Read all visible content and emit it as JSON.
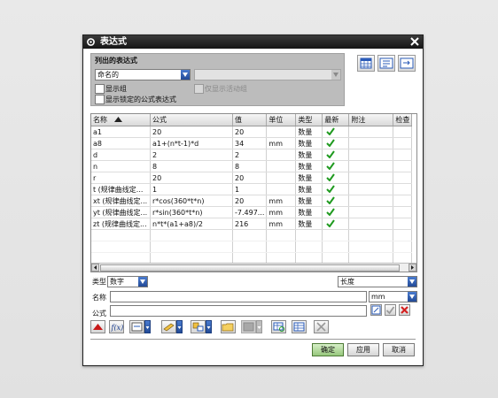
{
  "dialog": {
    "title": "表达式"
  },
  "list_group": {
    "title": "列出的表达式",
    "filter_value": "命名的",
    "secondary_value": "",
    "show_groups_label": "显示组",
    "active_group_only_label": "仅显示活动组",
    "show_locked_label": "显示锁定的公式表达式"
  },
  "table": {
    "columns": [
      "名称",
      "公式",
      "值",
      "单位",
      "类型",
      "最新",
      "附注",
      "检查"
    ],
    "rows": [
      {
        "name": "a1",
        "formula": "20",
        "value": "20",
        "unit": "",
        "type": "数量",
        "uptodate": true
      },
      {
        "name": "a8",
        "formula": "a1+(n*t-1)*d",
        "value": "34",
        "unit": "mm",
        "type": "数量",
        "uptodate": true
      },
      {
        "name": "d",
        "formula": "2",
        "value": "2",
        "unit": "",
        "type": "数量",
        "uptodate": true
      },
      {
        "name": "n",
        "formula": "8",
        "value": "8",
        "unit": "",
        "type": "数量",
        "uptodate": true
      },
      {
        "name": "r",
        "formula": "20",
        "value": "20",
        "unit": "",
        "type": "数量",
        "uptodate": true
      },
      {
        "name": "t (规律曲线定...",
        "formula": "1",
        "value": "1",
        "unit": "",
        "type": "数量",
        "uptodate": true
      },
      {
        "name": "xt (规律曲线定...",
        "formula": "r*cos(360*t*n)",
        "value": "20",
        "unit": "mm",
        "type": "数量",
        "uptodate": true
      },
      {
        "name": "yt (规律曲线定...",
        "formula": "r*sin(360*t*n)",
        "value": "-7.497...",
        "unit": "mm",
        "type": "数量",
        "uptodate": true
      },
      {
        "name": "zt (规律曲线定...",
        "formula": "n*t*(a1+a8)/2",
        "value": "216",
        "unit": "mm",
        "type": "数量",
        "uptodate": true
      }
    ]
  },
  "editor": {
    "type_label": "类型",
    "type_value": "数字",
    "dimension_value": "长度",
    "name_label": "名称",
    "name_value": "",
    "unit_value": "mm",
    "formula_label": "公式",
    "formula_value": ""
  },
  "buttons": {
    "ok": "确定",
    "apply": "应用",
    "cancel": "取消"
  },
  "icons": {
    "accent": "#2a5bb8",
    "check_color": "#1f9a1f",
    "reject_color": "#d42020"
  }
}
